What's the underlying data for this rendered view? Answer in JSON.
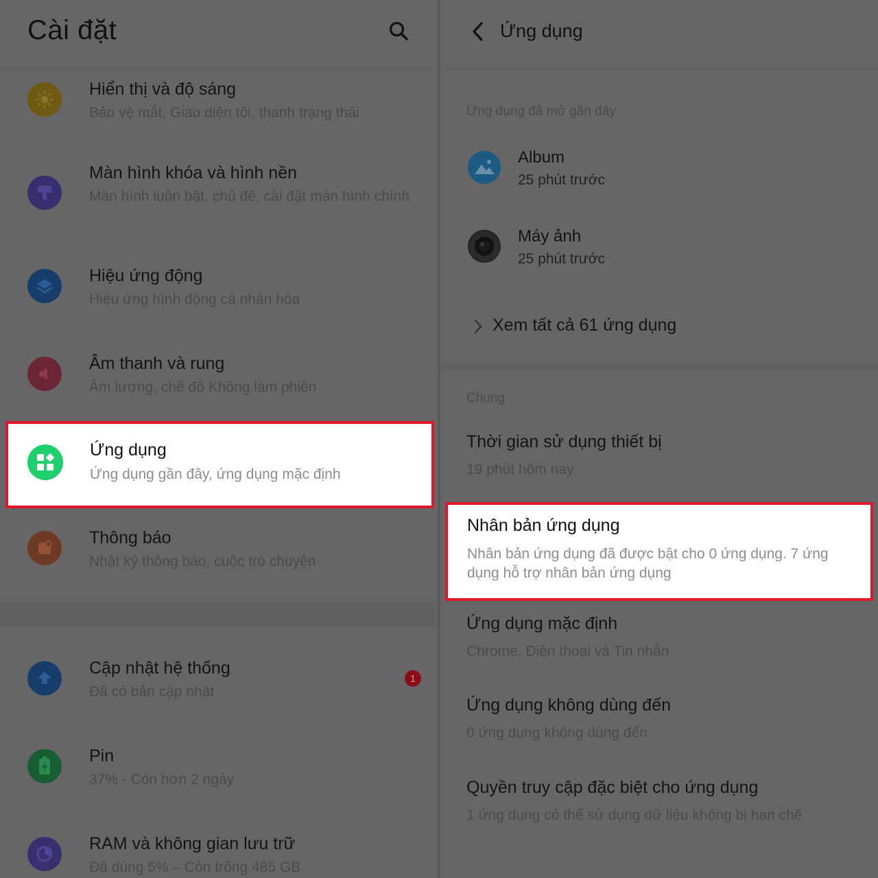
{
  "left": {
    "title": "Cài đặt",
    "search_icon": "search-icon",
    "items": [
      {
        "title": "Hiển thị và độ sáng",
        "subtitle": "Bảo vệ mắt, Giao diện tối, thanh trạng thái",
        "icon": "sun-icon",
        "color": "#6e5a12"
      },
      {
        "title": "Màn hình khóa và hình nền",
        "subtitle": "Màn hình luôn bật, chủ đề, cài đặt màn hình chính",
        "icon": "paint-roller-icon",
        "color": "#3a2f6e"
      },
      {
        "title": "Hiệu ứng động",
        "subtitle": "Hiệu ứng hình động cá nhân hóa",
        "icon": "layers-icon",
        "color": "#173e6b"
      },
      {
        "title": "Âm thanh và rung",
        "subtitle": "Âm lượng, chế độ Không làm phiền",
        "icon": "speaker-icon",
        "color": "#6b2533"
      },
      {
        "title": "Ứng dụng",
        "subtitle": "Ứng dụng gần đây, ứng dụng mặc định",
        "icon": "apps-grid-icon",
        "color": "#1fcf6b"
      },
      {
        "title": "Thông báo",
        "subtitle": "Nhật ký thông báo, cuộc trò chuyện",
        "icon": "notification-icon",
        "color": "#6e3a26"
      },
      {
        "title": "Cập nhật hệ thống",
        "subtitle": "Đã có bản cập nhật",
        "icon": "upload-arrow-icon",
        "color": "#173e6b",
        "badge": "1"
      },
      {
        "title": "Pin",
        "subtitle": "37% - Còn hơn 2 ngày",
        "icon": "battery-icon",
        "color": "#175f33"
      },
      {
        "title": "RAM và không gian lưu trữ",
        "subtitle": "Đã dùng 5% – Còn trống 485 GB",
        "icon": "pie-chart-icon",
        "color": "#3a2f6e"
      }
    ]
  },
  "right": {
    "title": "Ứng dụng",
    "back_icon": "chevron-left-icon",
    "recent_label": "Ứng dụng đã mở gần đây",
    "recent_apps": [
      {
        "name": "Album",
        "time": "25 phút trước",
        "icon": "album-icon"
      },
      {
        "name": "Máy ảnh",
        "time": "25 phút trước",
        "icon": "camera-icon"
      }
    ],
    "see_all": "Xem tất cả 61 ứng dụng",
    "general_label": "Chung",
    "options": [
      {
        "title": "Thời gian sử dụng thiết bị",
        "subtitle": "19 phút hôm nay"
      },
      {
        "title": "Nhân bản ứng dụng",
        "subtitle": "Nhân bản ứng dụng đã được bật cho 0 ứng dụng. 7 ứng dụng hỗ trợ nhân bản ứng dụng"
      },
      {
        "title": "Ứng dụng mặc định",
        "subtitle": "Chrome, Điện thoại và Tin nhắn"
      },
      {
        "title": "Ứng dụng không dùng đến",
        "subtitle": "0 ứng dụng không dùng đến"
      },
      {
        "title": "Quyền truy cập đặc biệt cho ứng dụng",
        "subtitle": "1 ứng dụng có thể sử dụng dữ liệu không bị hạn chế"
      }
    ]
  },
  "highlight_color": "#e0162b"
}
